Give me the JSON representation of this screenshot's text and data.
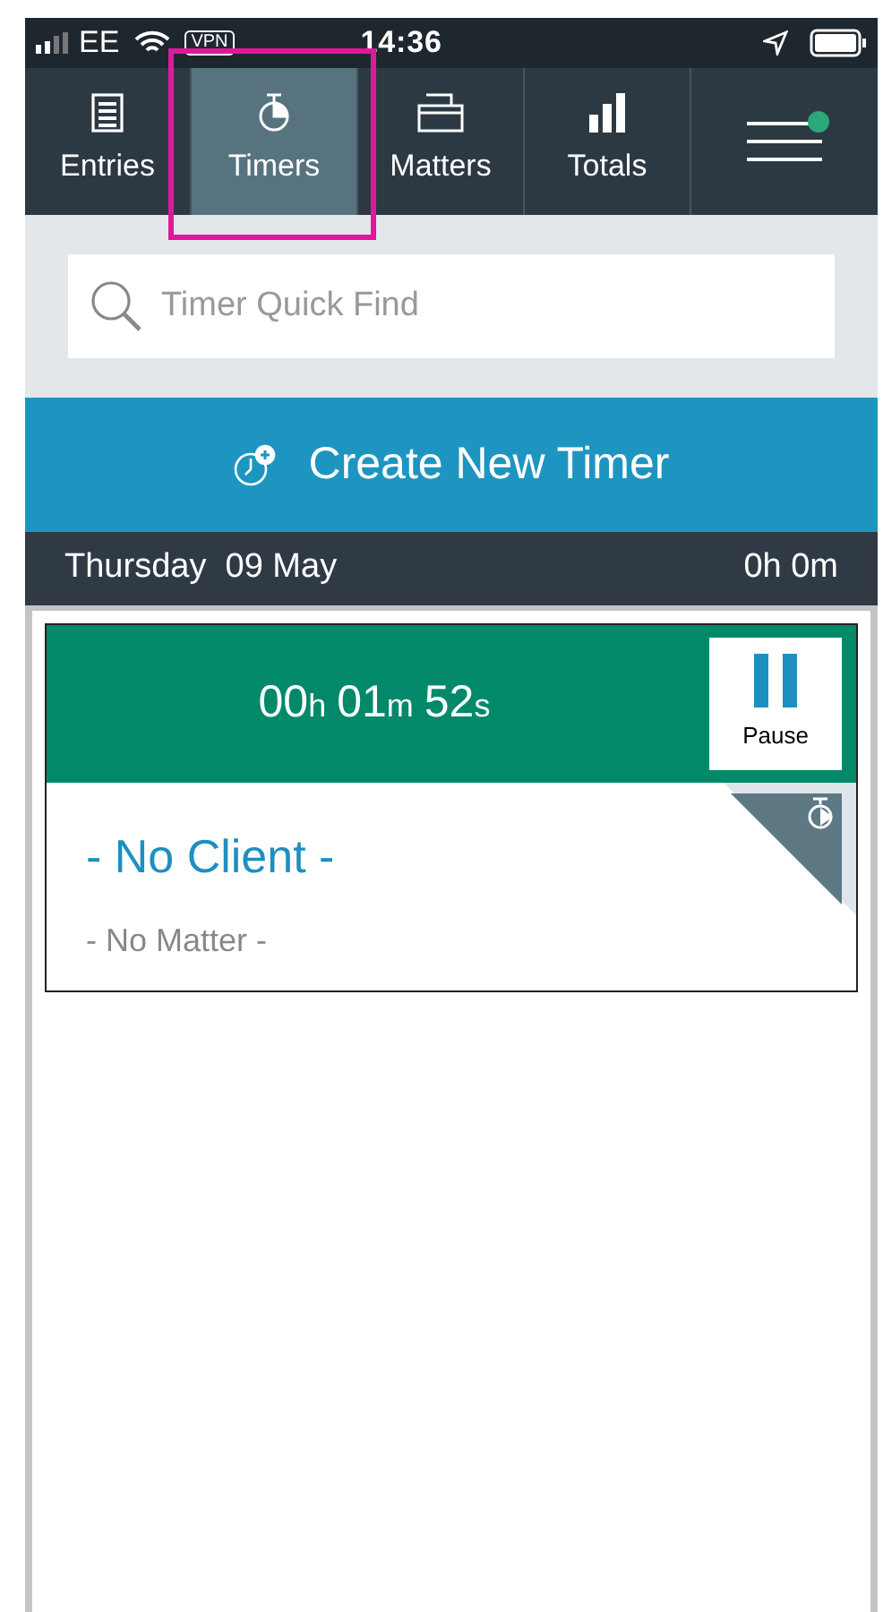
{
  "status_bar": {
    "carrier": "EE",
    "vpn": "VPN",
    "time": "14:36"
  },
  "tabs": [
    {
      "label": "Entries",
      "selected": false,
      "highlighted": false
    },
    {
      "label": "Timers",
      "selected": true,
      "highlighted": true
    },
    {
      "label": "Matters",
      "selected": false,
      "highlighted": false
    },
    {
      "label": "Totals",
      "selected": false,
      "highlighted": false
    }
  ],
  "menu": {
    "notification": true
  },
  "search": {
    "placeholder": "Timer Quick Find"
  },
  "create_button": {
    "label": "Create New Timer"
  },
  "day": {
    "date": "Thursday  09 May",
    "total": "0h 0m"
  },
  "timers": [
    {
      "elapsed": [
        {
          "value": "00",
          "unit": "h"
        },
        {
          "value": "01",
          "unit": "m"
        },
        {
          "value": "52",
          "unit": "s"
        }
      ],
      "action": "Pause",
      "running": true,
      "client": "- No Client -",
      "matter": "- No Matter -"
    }
  ]
}
